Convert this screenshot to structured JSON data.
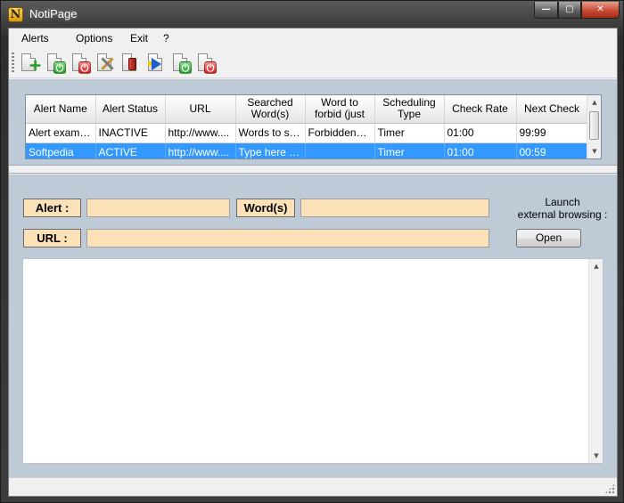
{
  "window": {
    "title": "NotiPage",
    "app_icon_letter": "N"
  },
  "caption_buttons": {
    "minimize": "—",
    "maximize": "▢",
    "close": "✕"
  },
  "menu": {
    "items": [
      "Alerts",
      "Options",
      "Exit",
      "?"
    ]
  },
  "toolbar": {
    "buttons": [
      {
        "name": "new-alert",
        "icon": "document-plus-icon"
      },
      {
        "name": "activate-alert",
        "icon": "document-power-green-icon"
      },
      {
        "name": "deactivate-alert",
        "icon": "document-power-red-icon"
      },
      {
        "name": "edit-alert",
        "icon": "document-tools-icon"
      },
      {
        "name": "delete-alert",
        "icon": "document-red-can-icon"
      },
      {
        "name": "check-alert",
        "icon": "document-arrow-icon"
      },
      {
        "name": "activate-all",
        "icon": "document-power-green-icon"
      },
      {
        "name": "deactivate-all",
        "icon": "document-power-red-icon"
      }
    ]
  },
  "grid": {
    "columns": [
      "Alert Name",
      "Alert Status",
      "URL",
      "Searched Word(s)",
      "Word to forbid (just",
      "Scheduling Type",
      "Check Rate",
      "Next Check"
    ],
    "rows": [
      [
        "Alert example",
        "INACTIVE",
        "http://www....",
        "Words to se...",
        "ForbiddenW...",
        "Timer",
        "01:00",
        "99:99"
      ],
      [
        "Softpedia",
        "ACTIVE",
        "http://www....",
        "Type here th...",
        "",
        "Timer",
        "01:00",
        "00:59"
      ]
    ],
    "selected_row": 1
  },
  "detail": {
    "alert_label": "Alert :",
    "words_label": "Word(s)",
    "url_label": "URL :",
    "alert_value": "",
    "words_value": "",
    "url_value": "",
    "launch_label_line1": "Launch",
    "launch_label_line2": "external browsing :",
    "open_button": "Open"
  },
  "colors": {
    "panel_bg": "#bfcad7",
    "field_bg": "#fbe1b8",
    "selection": "#3399ff"
  }
}
